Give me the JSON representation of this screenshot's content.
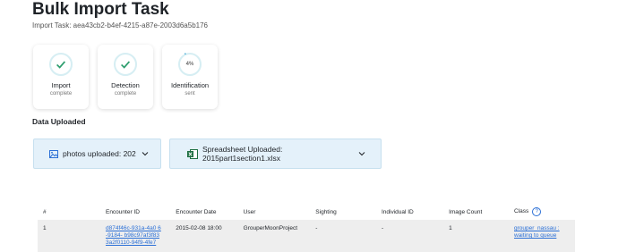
{
  "page": {
    "title": "Bulk Import Task",
    "subtitle": "Import Task: aea43cb2-b4ef-4215-a87e-2003d6a5b176"
  },
  "status_cards": [
    {
      "label": "Import",
      "sub": "complete",
      "state": "done"
    },
    {
      "label": "Detection",
      "sub": "complete",
      "state": "done"
    },
    {
      "label": "Identification",
      "sub": "sent",
      "state": "progress",
      "progress_text": "4%",
      "progress": 0.04
    }
  ],
  "data_uploaded": {
    "heading": "Data Uploaded",
    "photos_label": "photos uploaded: 202",
    "spreadsheet_label": "Spreadsheet Uploaded: 2015part1section1.xlsx"
  },
  "table": {
    "headers": [
      "#",
      "Encounter ID",
      "Encounter Date",
      "User",
      "Sighting",
      "Individual ID",
      "Image Count",
      "Class"
    ],
    "rows": [
      {
        "num": "1",
        "encounter_id": "d874f46c-931a-4a0 6-9184- b98c97af3f83 3a2f0110-94f9-4fe7",
        "date": "2015-02-08 18:00",
        "user": "GrouperMoonProject",
        "sighting": "-",
        "individual": "-",
        "image_count": "1",
        "class": "grouper_nassau : waiting to queue"
      }
    ]
  },
  "colors": {
    "accent": "#2e9e6e",
    "panel_bg": "#e4f1fa",
    "link": "#2a6fd6"
  }
}
